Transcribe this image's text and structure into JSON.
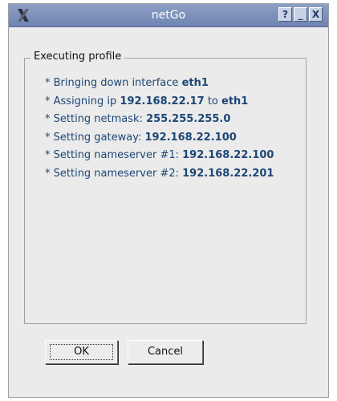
{
  "window": {
    "title": "netGo"
  },
  "titlebar_buttons": {
    "help": "?",
    "minimize": "_",
    "close": "X"
  },
  "group": {
    "title": "Executing profile"
  },
  "log": [
    {
      "prefix": "* Bringing down interface ",
      "value": "eth1",
      "suffix": ""
    },
    {
      "prefix": "* Assigning ip ",
      "value": "192.168.22.17",
      "mid": " to ",
      "value2": "eth1"
    },
    {
      "prefix": "* Setting netmask: ",
      "value": "255.255.255.0",
      "suffix": ""
    },
    {
      "prefix": "* Setting gateway: ",
      "value": "192.168.22.100",
      "suffix": ""
    },
    {
      "prefix": "* Setting nameserver #1: ",
      "value": "192.168.22.100",
      "suffix": ""
    },
    {
      "prefix": "* Setting nameserver #2: ",
      "value": "192.168.22.201",
      "suffix": ""
    }
  ],
  "buttons": {
    "ok": "OK",
    "cancel": "Cancel"
  },
  "icons": {
    "app": "x-logo-icon"
  },
  "colors": {
    "titlebar": "#7a8fba",
    "log_text": "#1c4775",
    "background": "#ebebeb"
  }
}
